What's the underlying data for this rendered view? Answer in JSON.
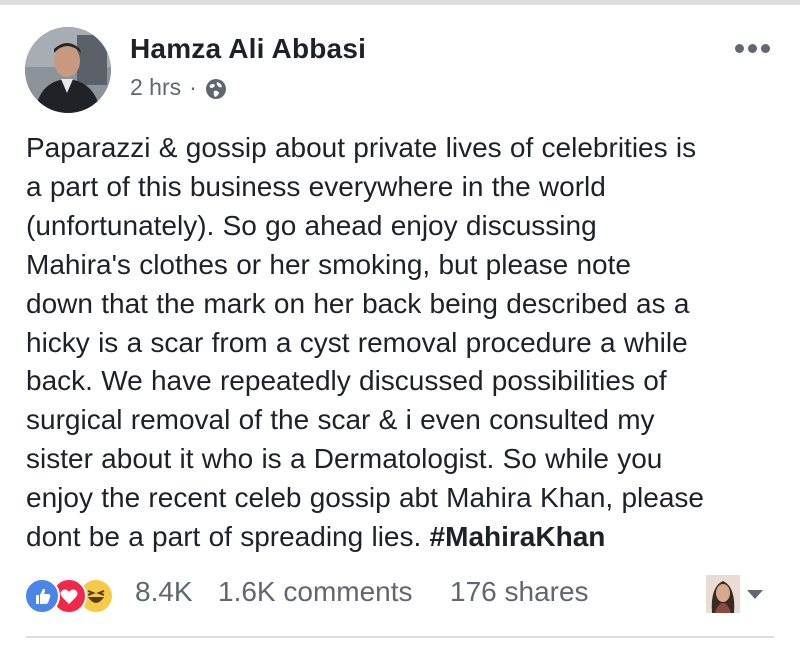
{
  "post": {
    "author": "Hamza Ali Abbasi",
    "time": "2 hrs",
    "separator": "·",
    "privacy_icon": "globe-icon",
    "menu_icon": "more-options-icon",
    "text_lines": [
      "Paparazzi & gossip about private lives of celebrities is",
      "a part of this business everywhere in the world",
      "(unfortunately). So go ahead enjoy discussing",
      "Mahira's clothes or her smoking, but please note",
      "down that the mark on her back being described as a",
      "hicky is a scar from a cyst removal procedure a while",
      "back. We have repeatedly discussed possibilities of",
      "surgical removal of the scar & i even consulted my",
      "sister about it who is a Dermatologist. So while you",
      "enjoy the recent celeb gossip abt Mahira Khan, please",
      "dont be a part of spreading lies. "
    ],
    "hashtag": "#MahiraKhan"
  },
  "reactions": {
    "icons": [
      "like-reaction-icon",
      "love-reaction-icon",
      "haha-reaction-icon"
    ],
    "count": "8.4K",
    "comments": "1.6K comments",
    "shares": "176 shares"
  },
  "colors": {
    "like": "#4a86e8",
    "love": "#f0284a",
    "haha": "#f7c948",
    "text": "#1d2129",
    "secondary": "#606770"
  }
}
